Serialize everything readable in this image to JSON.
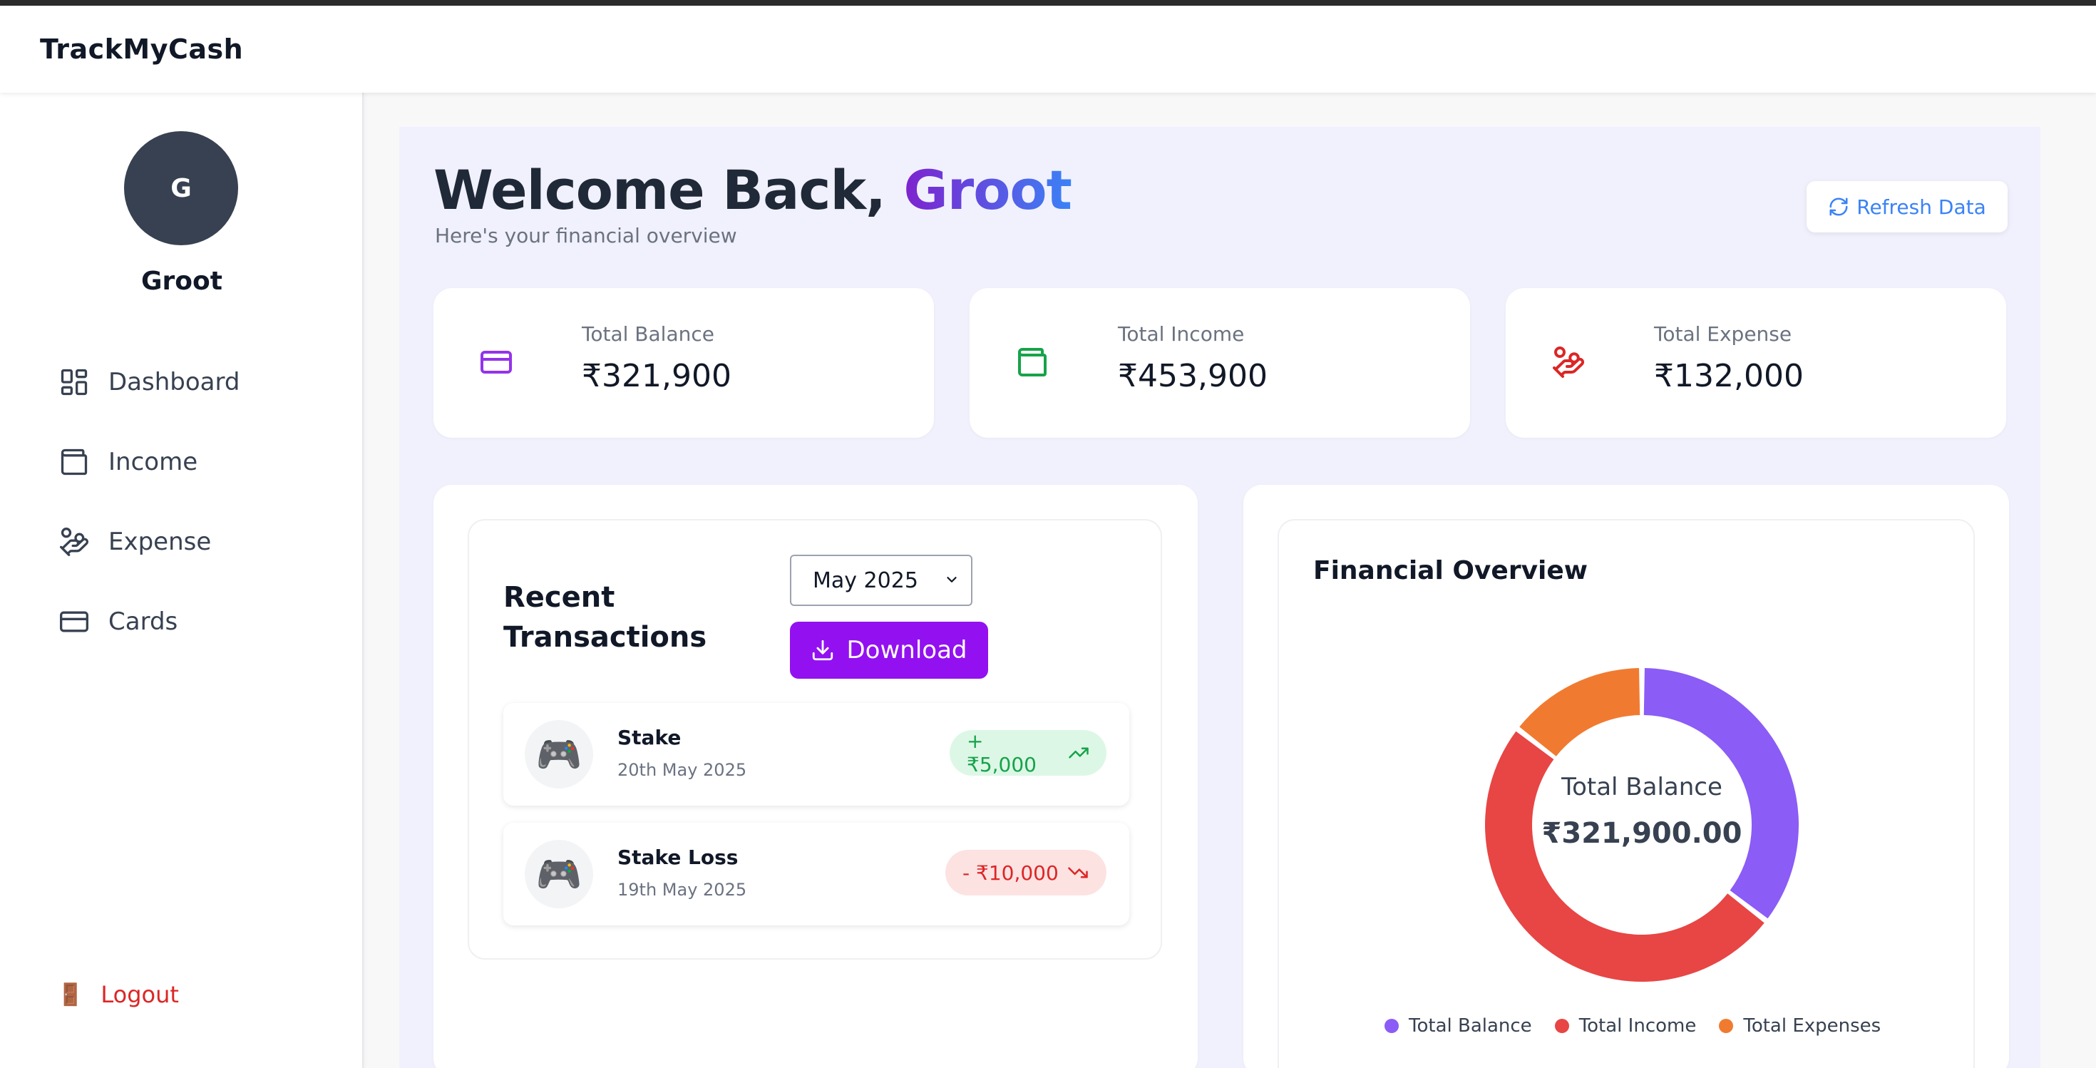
{
  "app": {
    "brand": "TrackMyCash"
  },
  "user": {
    "initial": "G",
    "name": "Groot"
  },
  "sidebar": {
    "items": [
      {
        "label": "Dashboard",
        "icon": "dashboard-icon"
      },
      {
        "label": "Income",
        "icon": "wallet-icon"
      },
      {
        "label": "Expense",
        "icon": "hand-coins-icon"
      },
      {
        "label": "Cards",
        "icon": "credit-card-icon"
      }
    ],
    "logout": "Logout"
  },
  "header": {
    "welcome_prefix": "Welcome Back,",
    "welcome_name": "Groot",
    "subtitle": "Here's your financial overview",
    "refresh_label": "Refresh Data"
  },
  "stats": [
    {
      "label": "Total Balance",
      "value": "₹321,900",
      "icon": "credit-card-icon",
      "color": "#9333ea"
    },
    {
      "label": "Total Income",
      "value": "₹453,900",
      "icon": "wallet-icon",
      "color": "#16a34a"
    },
    {
      "label": "Total Expense",
      "value": "₹132,000",
      "icon": "hand-coins-icon",
      "color": "#dc2626"
    }
  ],
  "transactions": {
    "title": "Recent Transactions",
    "month": "May 2025",
    "download_label": "Download",
    "items": [
      {
        "name": "Stake",
        "date": "20th May 2025",
        "amount": "+ ₹5,000",
        "type": "income",
        "icon": "🎮"
      },
      {
        "name": "Stake Loss",
        "date": "19th May 2025",
        "amount": "- ₹10,000",
        "type": "expense",
        "icon": "🎮"
      }
    ]
  },
  "overview": {
    "title": "Financial Overview",
    "center_label": "Total Balance",
    "center_value": "₹321,900.00"
  },
  "chart_data": {
    "type": "pie",
    "categories": [
      "Total Balance",
      "Total Income",
      "Total Expenses"
    ],
    "values": [
      321900,
      453900,
      132000
    ],
    "colors": [
      "#8b5cf6",
      "#e84545",
      "#f07b30"
    ],
    "legend": "bottom"
  }
}
